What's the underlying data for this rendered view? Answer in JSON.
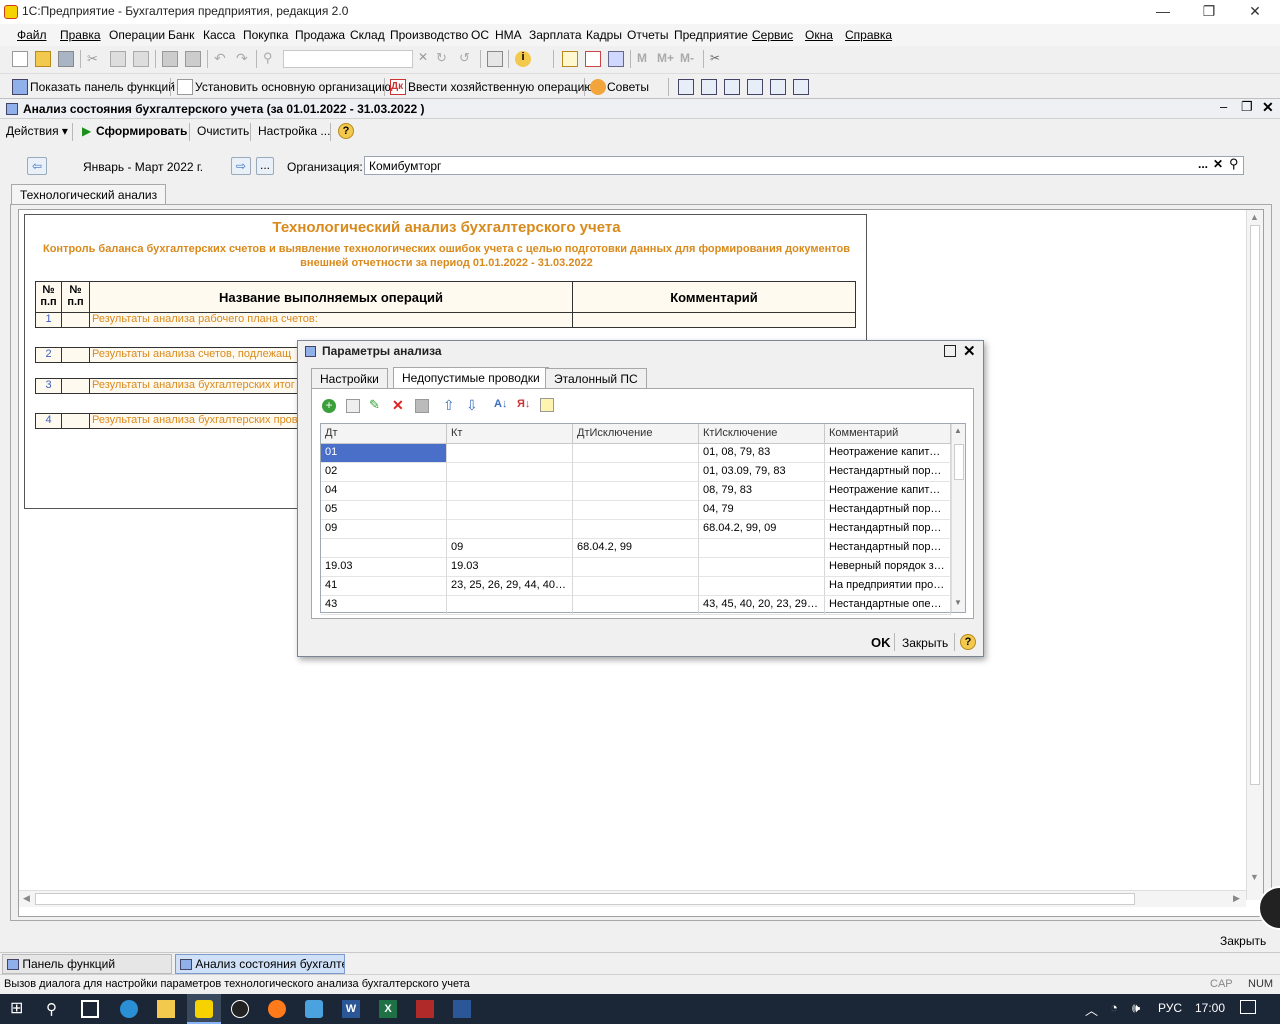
{
  "app": {
    "title": "1С:Предприятие - Бухгалтерия предприятия, редакция 2.0",
    "minimize": "—",
    "restore": "❐",
    "close": "✕"
  },
  "menu": [
    "Файл",
    "Правка",
    "Операции",
    "Банк",
    "Касса",
    "Покупка",
    "Продажа",
    "Склад",
    "Производство",
    "ОС",
    "НМА",
    "Зарплата",
    "Кадры",
    "Отчеты",
    "Предприятие",
    "Сервис",
    "Окна",
    "Справка"
  ],
  "toolbar2": {
    "show_panel": "Показать панель функций",
    "set_org": "Установить основную организацию",
    "enter_op": "Ввести хозяйственную операцию",
    "tips": "Советы"
  },
  "doc": {
    "title": "Анализ состояния бухгалтерского учета (за 01.01.2022  - 31.03.2022 )",
    "actions": "Действия",
    "generate": "Сформировать",
    "clear": "Очистить",
    "settings": "Настройка ...",
    "period": "Январь - Март 2022 г.",
    "org_label": "Организация:",
    "org_value": "Комибумторг",
    "ellipsis": "...",
    "tab": "Технологический анализ"
  },
  "report": {
    "title": "Технологический анализ бухгалтерского учета",
    "subtitle_line1": "Контроль баланса бухгалтерских счетов и выявление технологических ошибок учета с целью подготовки данных для формирования документов",
    "subtitle_line2": "внешней отчетности за период 01.01.2022  - 31.03.2022",
    "col_num1": "№ п.п",
    "col_num2": "№ п.п",
    "col_name": "Название выполняемых операций",
    "col_comment": "Комментарий",
    "rows": [
      {
        "n": "1",
        "text": "Результаты анализа рабочего плана счетов:"
      },
      {
        "n": "2",
        "text": "Результаты анализа счетов, подлежащ"
      },
      {
        "n": "3",
        "text": "Результаты анализа бухгалтерских итог"
      },
      {
        "n": "4",
        "text": "Результаты анализа бухгалтерских пров"
      }
    ]
  },
  "dialog": {
    "title": "Параметры анализа",
    "tabs": [
      "Настройки",
      "Недопустимые проводки",
      "Эталонный ПС"
    ],
    "columns": [
      "Дт",
      "Кт",
      "ДтИсключение",
      "КтИсключение",
      "Комментарий"
    ],
    "rows": [
      [
        "01",
        "",
        "",
        "01, 08, 79, 83",
        "Неотражение капитал..."
      ],
      [
        "02",
        "",
        "",
        "01, 03.09, 79, 83",
        "Нестандартный поряд..."
      ],
      [
        "04",
        "",
        "",
        "08, 79, 83",
        "Неотражение капитал..."
      ],
      [
        "05",
        "",
        "",
        "04, 79",
        "Нестандартный поряд..."
      ],
      [
        "09",
        "",
        "",
        "68.04.2, 99, 09",
        "Нестандартный поряд..."
      ],
      [
        "",
        "09",
        "68.04.2, 99",
        "",
        "Нестандартный поряд..."
      ],
      [
        "19.03",
        "19.03",
        "",
        "",
        "Неверный порядок за..."
      ],
      [
        "41",
        "23, 25, 26, 29, 44, 40, ...",
        "",
        "",
        "На предприятии прои..."
      ],
      [
        "43",
        "",
        "",
        "43, 45, 40, 20, 23, 29, ...",
        "Нестандартные опера..."
      ]
    ],
    "ok": "OK",
    "close": "Закрыть"
  },
  "bottom": {
    "close": "Закрыть",
    "wintab1": "Панель функций",
    "wintab2": "Анализ состояния бухгалте...",
    "status": "Вызов диалога для настройки параметров технологического анализа бухгалтерского учета",
    "cap": "CAP",
    "num": "NUM"
  },
  "taskbar": {
    "lang": "РУС",
    "time": "17:00"
  },
  "colors": {
    "accent": "#d98a1c",
    "selection": "#4a6fc9",
    "taskbar": "#1b2636"
  }
}
